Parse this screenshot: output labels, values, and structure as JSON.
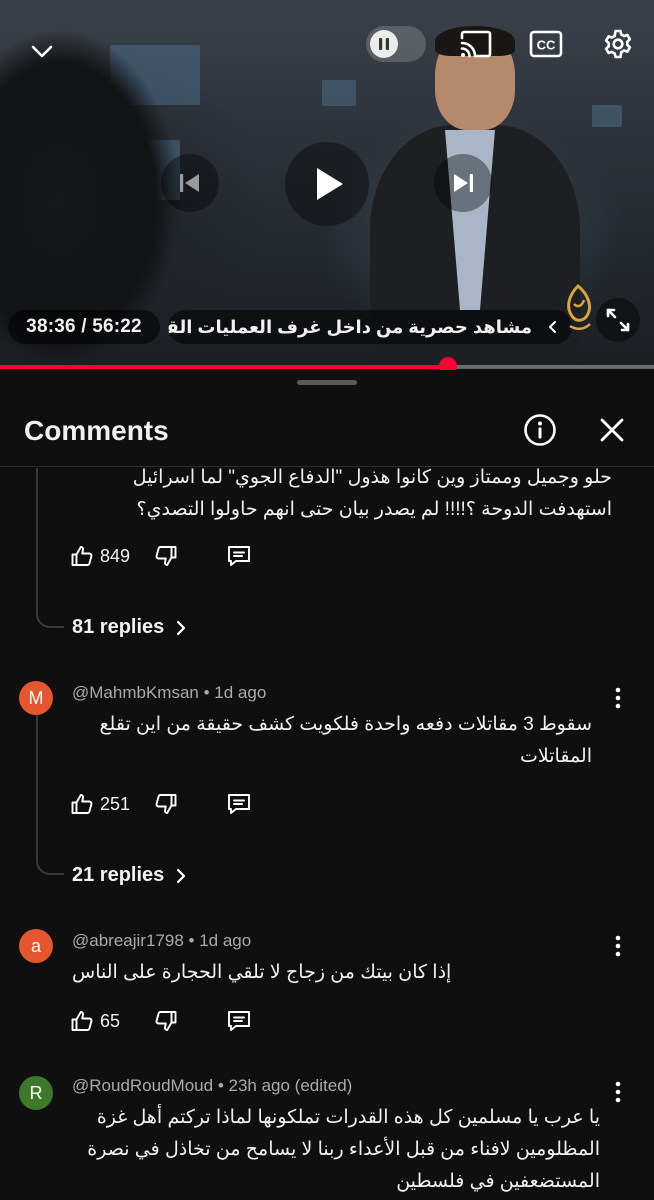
{
  "player": {
    "time_current": "38:36",
    "time_total": "56:22",
    "time_display": "38:36 / 56:22",
    "video_title": "مشاهد حصرية من داخل غرف العمليات القطرية",
    "progress_fraction": 0.685,
    "accent_color": "#ff0033",
    "icons": {
      "minimize": "chevron-down-icon",
      "autoplay": "pause-toggle-icon",
      "cast": "cast-icon",
      "captions": "cc-icon",
      "settings": "gear-icon",
      "previous": "skip-previous-icon",
      "play": "play-icon",
      "next": "skip-next-icon",
      "fullscreen": "fullscreen-icon"
    }
  },
  "panel": {
    "title": "Comments",
    "info_icon": "info-icon",
    "close_icon": "close-icon"
  },
  "comments": [
    {
      "text": "حلو وجميل وممتاز وين كانوا هذول \"الدفاع الجوي\" لما اسرائيل استهدفت الدوحة ؟!!!! لم يصدر بيان حتى انهم حاولوا التصدي؟",
      "likes": "849",
      "replies_label": "81 replies"
    },
    {
      "avatar_letter": "M",
      "avatar_color": "#e4572e",
      "author": "@MahmbKmsan",
      "time": "1d ago",
      "text": "سقوط 3 مقاتلات دفعه واحدة فلكويت كشف حقيقة من اين تقلع المقاتلات",
      "likes": "251",
      "replies_label": "21 replies"
    },
    {
      "avatar_letter": "a",
      "avatar_color": "#e4572e",
      "author": "@abreajir1798",
      "time": "1d ago",
      "text": "إذا كان بيتك من زجاج لا تلقي الحجارة على الناس",
      "likes": "65"
    },
    {
      "avatar_letter": "R",
      "avatar_color": "#3c7a2a",
      "author": "@RoudRoudMoud",
      "time": "23h ago (edited)",
      "text": "يا عرب يا مسلمين كل هذه القدرات تملكونها  لماذا تركتم أهل غزة المظلومين لافناء من قبل الأعداء ربنا لا يسامح من تخاذل في نصرة المستضعفين في فلسطين"
    }
  ]
}
